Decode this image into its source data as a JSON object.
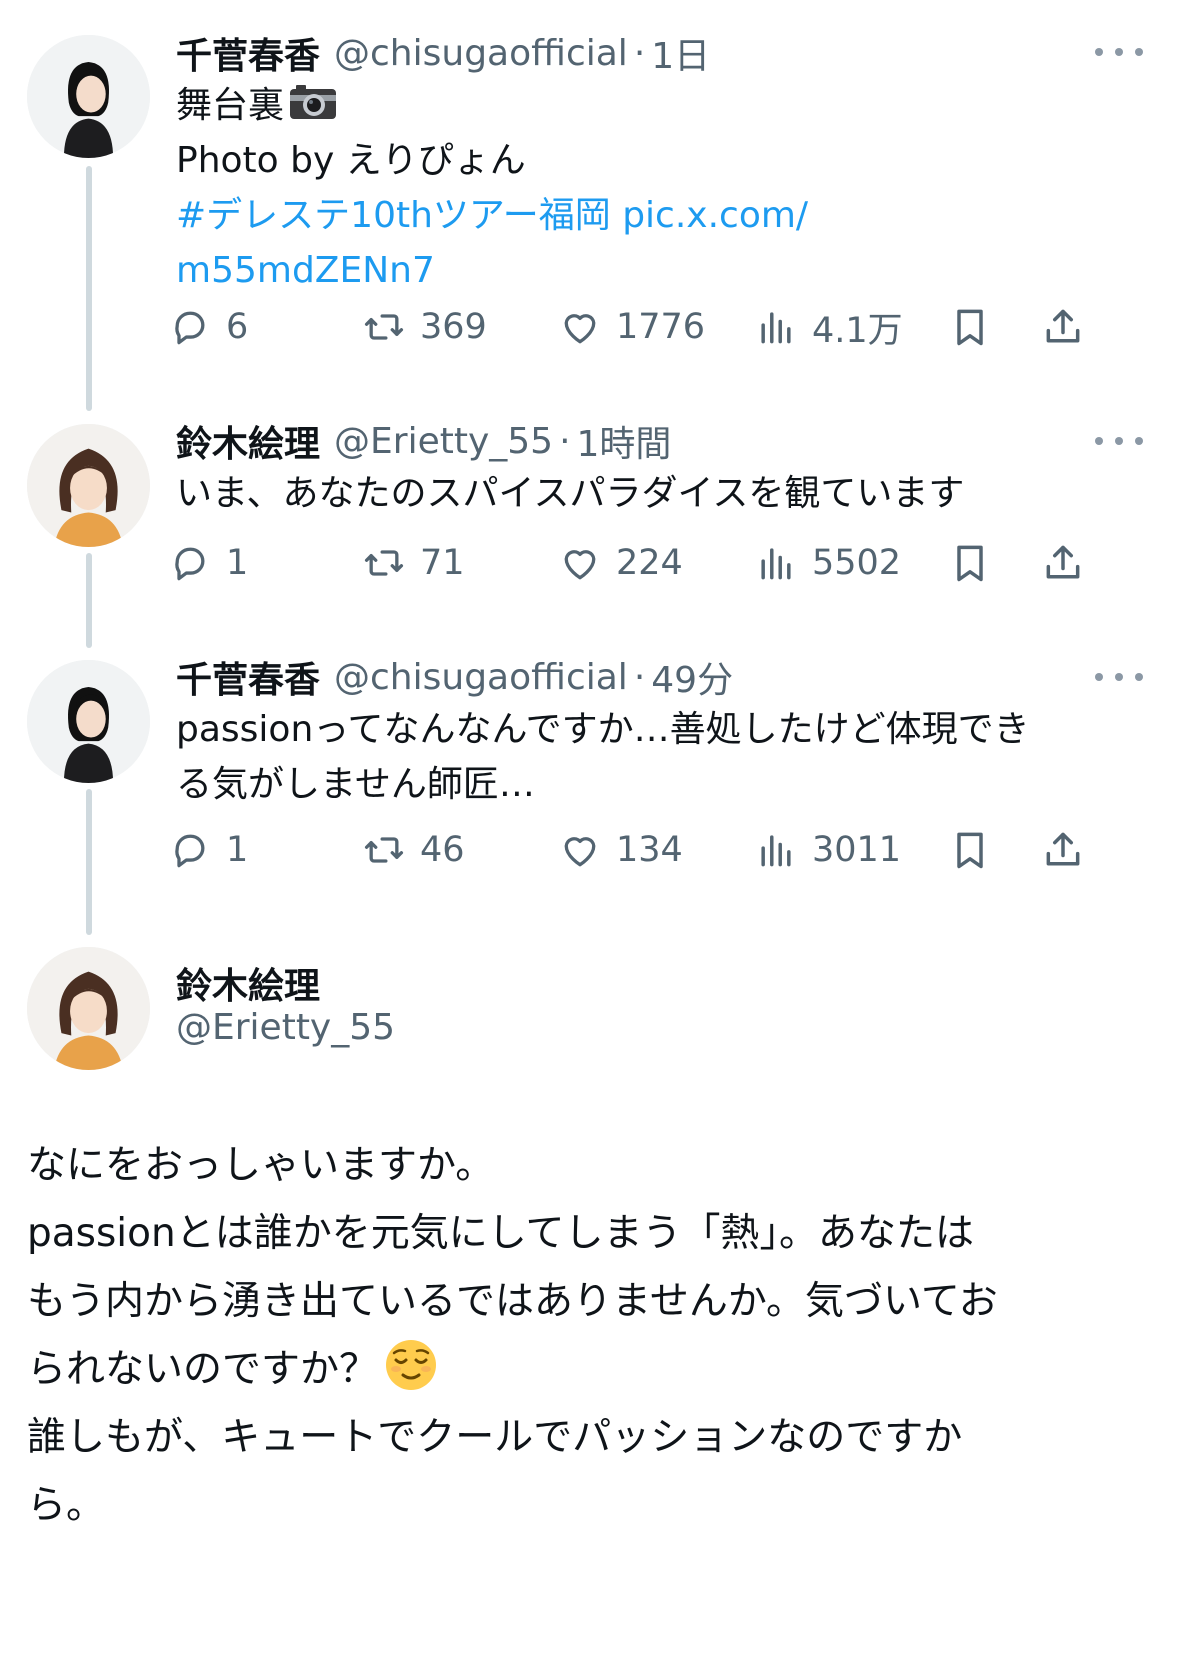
{
  "thread": [
    {
      "name": "千菅春香",
      "handle": "@chisugaofficial",
      "dot": "·",
      "time": "1日",
      "text_lines": [
        "舞台裏",
        "Photo by えりぴょん"
      ],
      "link_lines": [
        "#デレステ10thツアー福岡 pic.x.com/",
        "m55mdZENn7"
      ],
      "replies": "6",
      "reposts": "369",
      "likes": "1776",
      "views": "4.1万"
    },
    {
      "name": "鈴木絵理",
      "handle": "@Erietty_55",
      "dot": "·",
      "time": "1時間",
      "text_lines": [
        "いま、あなたのスパイスパラダイスを観ています"
      ],
      "replies": "1",
      "reposts": "71",
      "likes": "224",
      "views": "5502"
    },
    {
      "name": "千菅春香",
      "handle": "@chisugaofficial",
      "dot": "·",
      "time": "49分",
      "text_lines": [
        "passionってなんなんですか…善処したけど体現でき",
        "る気がしません師匠…"
      ],
      "replies": "1",
      "reposts": "46",
      "likes": "134",
      "views": "3011"
    }
  ],
  "main_tweet": {
    "name": "鈴木絵理",
    "handle": "@Erietty_55",
    "lines": [
      "なにをおっしゃいますか。",
      "passionとは誰かを元気にしてしまう「熱」。あなたは",
      "もう内から湧き出ているではありませんか。気づいてお",
      "られないのですか？",
      "誰しもが、キュートでクールでパッションなのですか",
      "ら。"
    ]
  },
  "icons": [
    "camera-emoji",
    "relieved-face-emoji",
    "reply-icon",
    "repost-icon",
    "like-icon",
    "views-icon",
    "bookmark-icon",
    "share-icon",
    "more-icon"
  ],
  "colors": {
    "link": "#1d9bf0",
    "secondary": "#536471",
    "thread_line": "#cfd9de"
  }
}
